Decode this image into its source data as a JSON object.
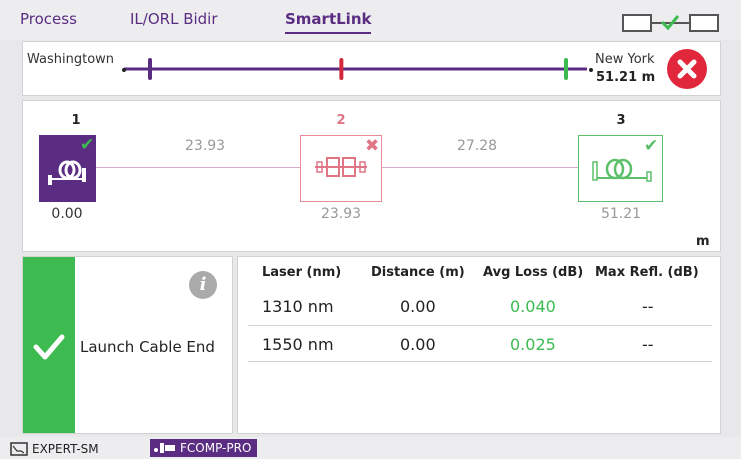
{
  "tabs": [
    {
      "label": "Process",
      "active": false
    },
    {
      "label": "IL/ORL Bidir",
      "active": false
    },
    {
      "label": "SmartLink",
      "active": true
    }
  ],
  "header": {
    "connection_icon": "link-status-icon"
  },
  "route": {
    "from": "Washingtown",
    "to": "New York",
    "distance": "51.21 m",
    "status_icon": "fail-x-icon",
    "markers": [
      {
        "color": "#5a2d82",
        "position_fraction": 0.0
      },
      {
        "color": "#d2283e",
        "position_fraction": 0.46
      },
      {
        "color": "#3dbb51",
        "position_fraction": 1.0
      }
    ]
  },
  "event_map": {
    "events": [
      {
        "number": "1",
        "position": "0.00",
        "status": "pass",
        "icon": "launch-cable-icon",
        "number_color": "#222222",
        "position_color": "#333333"
      },
      {
        "number": "2",
        "position": "23.93",
        "status": "fail",
        "icon": "connector-icon",
        "number_color": "#e07585",
        "position_color": "#999999"
      },
      {
        "number": "3",
        "position": "51.21",
        "status": "pass",
        "icon": "fiber-spool-icon",
        "number_color": "#222222",
        "position_color": "#999999"
      }
    ],
    "segments": [
      "23.93",
      "27.28"
    ],
    "unit": "m"
  },
  "status_card": {
    "label": "Launch Cable End",
    "status": "pass",
    "info_icon": "info-icon",
    "info_glyph": "i"
  },
  "results": {
    "columns": [
      "Laser (nm)",
      "Distance (m)",
      "Avg Loss (dB)",
      "Max Refl. (dB)"
    ],
    "rows": [
      {
        "laser": "1310 nm",
        "distance": "0.00",
        "avg_loss": "0.040",
        "max_refl": "--"
      },
      {
        "laser": "1550 nm",
        "distance": "0.00",
        "avg_loss": "0.025",
        "max_refl": "--"
      }
    ]
  },
  "footer": {
    "module1": "EXPERT-SM",
    "module2": "FCOMP-PRO"
  },
  "colors": {
    "accent": "#5a2d82",
    "pass": "#3dbb51",
    "fail": "#e0273b"
  }
}
